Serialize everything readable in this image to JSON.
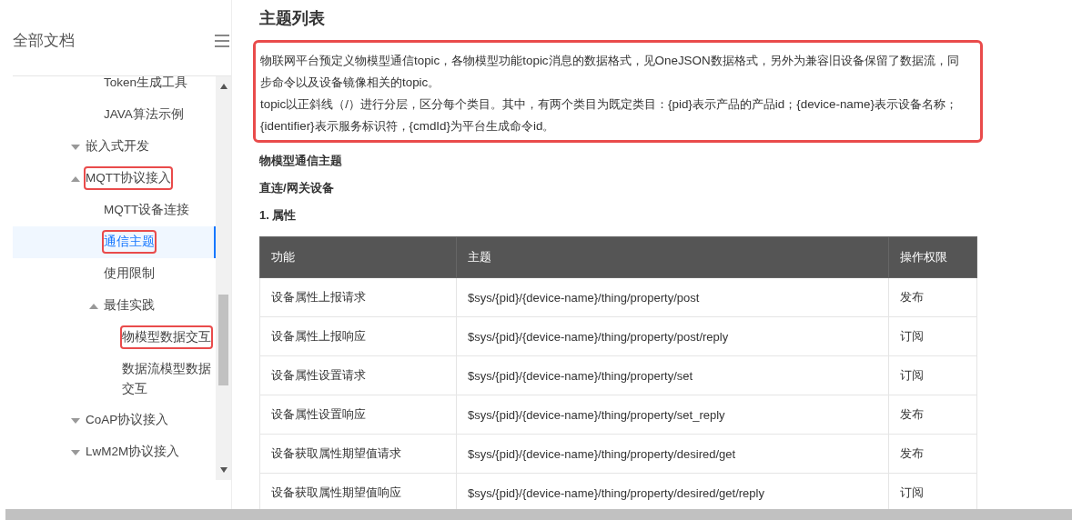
{
  "sidebar": {
    "title": "全部文档",
    "items": [
      {
        "label": "Token生成工具",
        "selected": false,
        "highlighted": false
      },
      {
        "label": "JAVA算法示例",
        "selected": false,
        "highlighted": false
      },
      {
        "label": "嵌入式开发",
        "selected": false,
        "highlighted": false,
        "expanded": false
      },
      {
        "label": "MQTT协议接入",
        "selected": false,
        "highlighted": true,
        "expanded": true,
        "children": [
          {
            "label": "MQTT设备连接",
            "selected": false,
            "highlighted": false
          },
          {
            "label": "通信主题",
            "selected": true,
            "highlighted": true
          },
          {
            "label": "使用限制",
            "selected": false,
            "highlighted": false
          },
          {
            "label": "最佳实践",
            "selected": false,
            "highlighted": false,
            "expanded": true,
            "children": [
              {
                "label": "物模型数据交互",
                "selected": false,
                "highlighted": true
              },
              {
                "label": "数据流模型数据交互",
                "selected": false,
                "highlighted": false
              }
            ]
          }
        ]
      },
      {
        "label": "CoAP协议接入",
        "selected": false,
        "highlighted": false,
        "expanded": false
      },
      {
        "label": "LwM2M协议接入",
        "selected": false,
        "highlighted": false,
        "expanded": false
      }
    ]
  },
  "content": {
    "title": "主题列表",
    "intro": {
      "highlighted": true,
      "paragraphs": [
        "物联网平台预定义物模型通信topic，各物模型功能topic消息的数据格式，见OneJSON数据格式，另外为兼容旧设备保留了数据流，同步命令以及设备镜像相关的topic。",
        "topic以正斜线（/）进行分层，区分每个类目。其中，有两个类目为既定类目：{pid}表示产品的产品id；{device-name}表示设备名称；{identifier}表示服务标识符，{cmdId}为平台生成命令id。"
      ]
    },
    "headings": [
      "物模型通信主题",
      "直连/网关设备",
      "1. 属性"
    ],
    "table": {
      "columns": [
        "功能",
        "主题",
        "操作权限"
      ],
      "rows": [
        [
          "设备属性上报请求",
          "$sys/{pid}/{device-name}/thing/property/post",
          "发布"
        ],
        [
          "设备属性上报响应",
          "$sys/{pid}/{device-name}/thing/property/post/reply",
          "订阅"
        ],
        [
          "设备属性设置请求",
          "$sys/{pid}/{device-name}/thing/property/set",
          "订阅"
        ],
        [
          "设备属性设置响应",
          "$sys/{pid}/{device-name}/thing/property/set_reply",
          "发布"
        ],
        [
          "设备获取属性期望值请求",
          "$sys/{pid}/{device-name}/thing/property/desired/get",
          "发布"
        ],
        [
          "设备获取属性期望值响应",
          "$sys/{pid}/{device-name}/thing/property/desired/get/reply",
          "订阅"
        ]
      ]
    }
  }
}
